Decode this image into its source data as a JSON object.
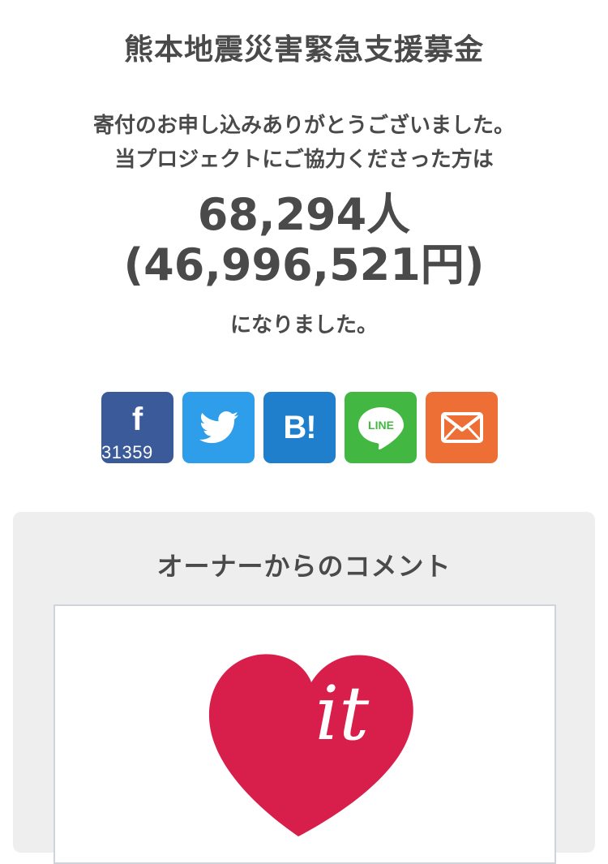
{
  "page": {
    "title": "熊本地震災害緊急支援募金",
    "thanks_line1": "寄付のお申し込みありがとうございました。",
    "thanks_line2": "当プロジェクトにご協力くださった方は",
    "supporters": "68,294人",
    "amount": "(46,996,521円)",
    "outro": "になりました。"
  },
  "share": {
    "facebook": {
      "glyph": "f",
      "count": "31359",
      "icon": "facebook-icon",
      "color": "#3b5a9a"
    },
    "twitter": {
      "icon": "twitter-bird-icon",
      "color": "#2f9eea"
    },
    "hatena": {
      "label": "B!",
      "icon": "hatena-bookmark-icon",
      "color": "#1f7fcc"
    },
    "line": {
      "label": "LINE",
      "icon": "line-icon",
      "color": "#42b843"
    },
    "mail": {
      "icon": "mail-envelope-icon",
      "color": "#ee6f35"
    }
  },
  "comment": {
    "heading": "オーナーからのコメント",
    "logo": {
      "text": "it",
      "icon": "heart-logo-icon",
      "color": "#d81e4a"
    }
  }
}
